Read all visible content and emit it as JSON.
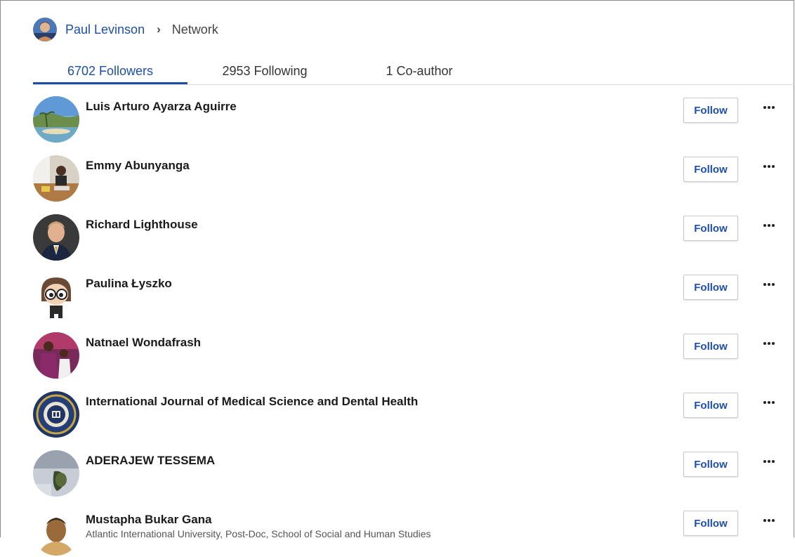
{
  "breadcrumb": {
    "user": "Paul Levinson",
    "separator": "›",
    "page": "Network"
  },
  "tabs": [
    {
      "label": "6702 Followers",
      "active": true
    },
    {
      "label": "2953 Following",
      "active": false
    },
    {
      "label": "1 Co-author",
      "active": false
    }
  ],
  "accent_color": "#1d4fa6",
  "people": [
    {
      "name": "Luis Arturo Ayarza Aguirre",
      "subtitle": "",
      "button": "Follow",
      "avatar": "beach-photo"
    },
    {
      "name": "Emmy Abunyanga",
      "subtitle": "",
      "button": "Follow",
      "avatar": "desk-photo"
    },
    {
      "name": "Richard Lighthouse",
      "subtitle": "",
      "button": "Follow",
      "avatar": "portrait-photo"
    },
    {
      "name": "Paulina Łyszko",
      "subtitle": "",
      "button": "Follow",
      "avatar": "cartoon-avatar"
    },
    {
      "name": "Natnael Wondafrash",
      "subtitle": "",
      "button": "Follow",
      "avatar": "group-photo"
    },
    {
      "name": "International Journal of Medical Science and Dental Health",
      "subtitle": "",
      "button": "Follow",
      "avatar": "journal-seal"
    },
    {
      "name": "ADERAJEW TESSEMA",
      "subtitle": "",
      "button": "Follow",
      "avatar": "blurry-photo"
    },
    {
      "name": "Mustapha Bukar Gana",
      "subtitle": "Atlantic International University, Post-Doc, School of Social and Human Studies",
      "button": "Follow",
      "avatar": "portrait-photo"
    }
  ]
}
